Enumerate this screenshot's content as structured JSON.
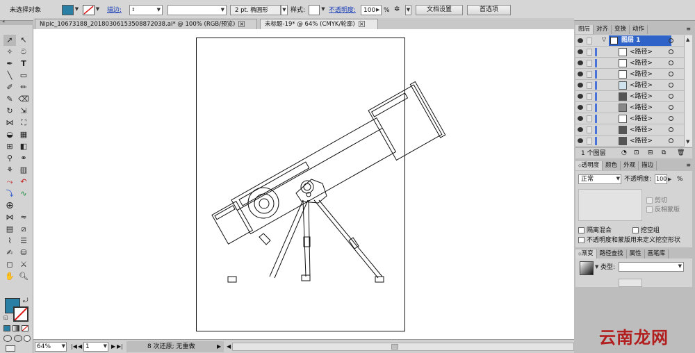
{
  "control_bar": {
    "selection_status": "未选择对象",
    "fill_color": "#2a7fa5",
    "stroke_label": "描边:",
    "brush_label": "2 pt. 椭圆形",
    "style_label": "样式:",
    "opacity_label": "不透明度:",
    "opacity_value": "100",
    "opacity_unit": "%",
    "doc_setup_button": "文档设置",
    "preferences_button": "首选项"
  },
  "document_tabs": [
    {
      "title": "Nipic_10673188_20180306153508872038.ai* @ 100% (RGB/预览)"
    },
    {
      "title": "未标题-19* @ 64% (CMYK/轮廓)"
    }
  ],
  "status_bar": {
    "zoom": "64%",
    "artboard_number": "1",
    "status_text": "8 次还原; 无重做"
  },
  "layers_panel": {
    "tabs": [
      "图层",
      "对齐",
      "变换",
      "动作"
    ],
    "layer_name": "图层 1",
    "paths": [
      "<路径>",
      "<路径>",
      "<路径>",
      "<路径>",
      "<路径>",
      "<路径>",
      "<路径>",
      "<路径>",
      "<路径>"
    ],
    "footer_text": "1 个图层"
  },
  "transparency_panel": {
    "tabs": [
      "透明度",
      "颜色",
      "外观",
      "描边"
    ],
    "blend_mode": "正常",
    "opacity_label": "不透明度:",
    "opacity_value": "100",
    "opacity_unit": "%",
    "clip_label": "剪切",
    "invert_mask_label": "反相蒙版",
    "isolate_blending_label": "隔离混合",
    "knockout_group_label": "挖空组",
    "opacity_mask_label": "不透明度和蒙版用来定义挖空形状"
  },
  "gradient_panel": {
    "tabs": [
      "渐变",
      "路径查找",
      "属性",
      "画笔库"
    ],
    "type_label": "类型:"
  },
  "watermark": "云南龙网",
  "colors": {
    "fill": "#2a7fa5",
    "selected_layer": "#2f63c7",
    "canvas": "#ffffff"
  }
}
